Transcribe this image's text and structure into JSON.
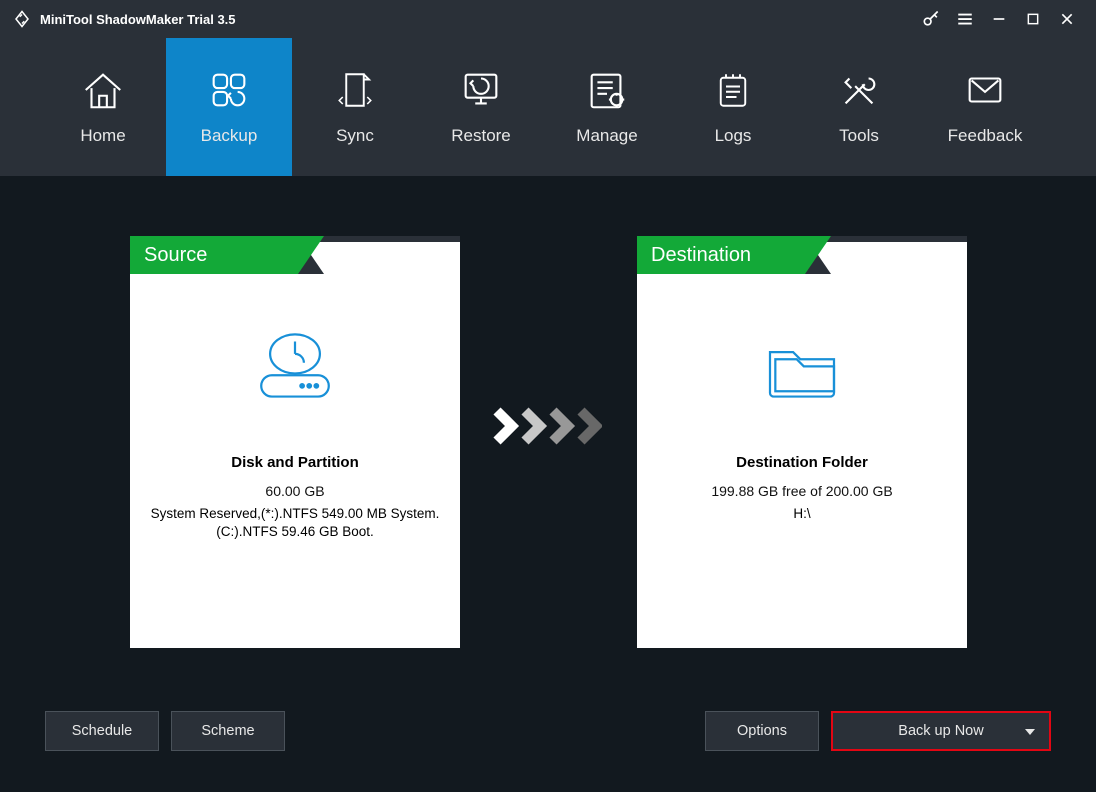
{
  "titlebar": {
    "title": "MiniTool ShadowMaker Trial 3.5"
  },
  "nav": {
    "items": [
      {
        "label": "Home"
      },
      {
        "label": "Backup"
      },
      {
        "label": "Sync"
      },
      {
        "label": "Restore"
      },
      {
        "label": "Manage"
      },
      {
        "label": "Logs"
      },
      {
        "label": "Tools"
      },
      {
        "label": "Feedback"
      }
    ],
    "active_index": 1
  },
  "source": {
    "header": "Source",
    "title": "Disk and Partition",
    "size": "60.00 GB",
    "details_line1": "System Reserved,(*:).NTFS 549.00 MB System.",
    "details_line2": "(C:).NTFS 59.46 GB Boot."
  },
  "destination": {
    "header": "Destination",
    "title": "Destination Folder",
    "free": "199.88 GB free of 200.00 GB",
    "path": "H:\\"
  },
  "buttons": {
    "schedule": "Schedule",
    "scheme": "Scheme",
    "options": "Options",
    "backup_now": "Back up Now"
  },
  "colors": {
    "accent_blue": "#0e85c9",
    "accent_green": "#13a938",
    "highlight_red": "#e30613",
    "panel_dark": "#2a3038",
    "bg": "#12191f"
  }
}
